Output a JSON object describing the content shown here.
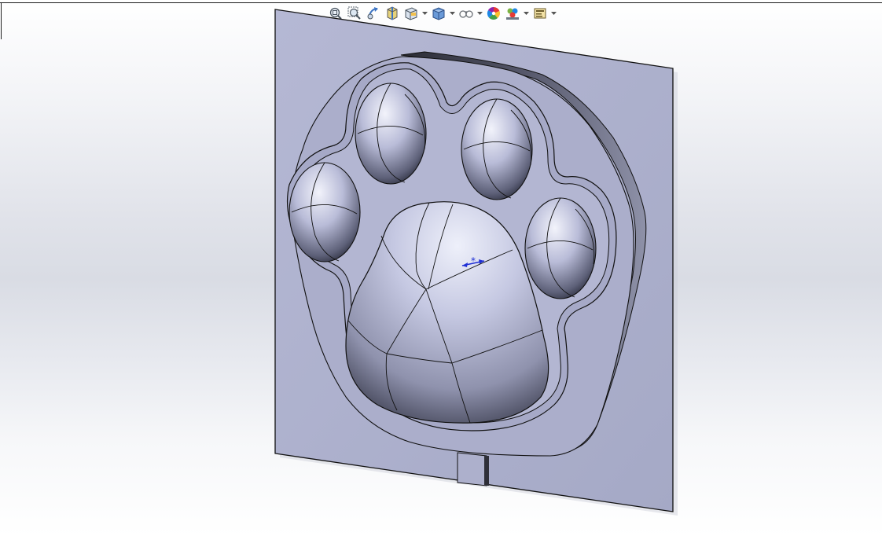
{
  "window": {
    "type": "cad-graphics-area",
    "background": "#e1e3ea"
  },
  "toolbar": {
    "buttons": [
      {
        "name": "zoom-to-fit-icon",
        "has_dropdown": false
      },
      {
        "name": "zoom-to-area-icon",
        "has_dropdown": false
      },
      {
        "name": "previous-view-icon",
        "has_dropdown": false
      },
      {
        "name": "section-view-icon",
        "has_dropdown": false
      },
      {
        "name": "dynamic-annotation-views-icon",
        "has_dropdown": true
      },
      {
        "name": "view-orientation-icon",
        "has_dropdown": true
      },
      {
        "name": "display-style-icon",
        "has_dropdown": true
      },
      {
        "name": "hide-show-items-icon",
        "has_dropdown": false
      },
      {
        "name": "edit-appearance-icon",
        "has_dropdown": false
      },
      {
        "name": "apply-scene-icon",
        "has_dropdown": true
      },
      {
        "name": "view-settings-icon",
        "has_dropdown": true
      }
    ]
  },
  "model": {
    "description_visible_text": "",
    "plate_color": "#aaaecb",
    "edge_color": "#111111",
    "dimension_marker_color": "#1f2fd6"
  }
}
